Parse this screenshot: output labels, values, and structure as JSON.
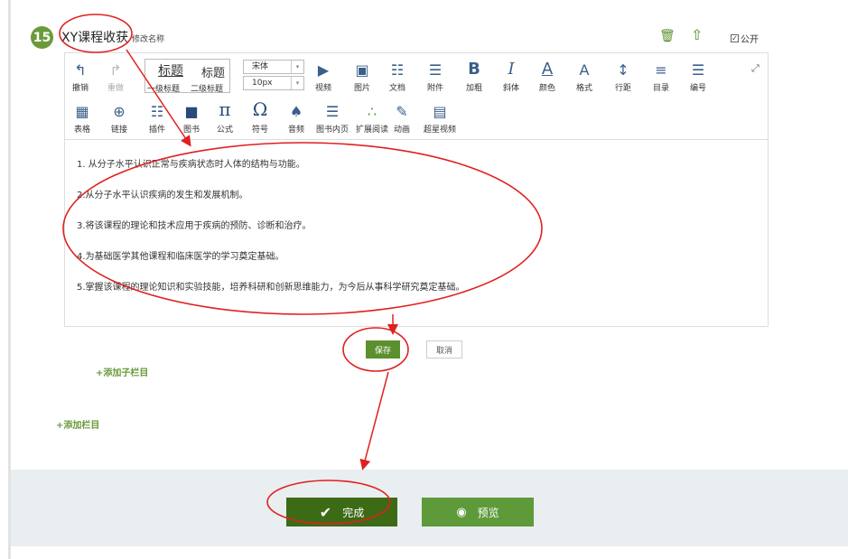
{
  "section": {
    "number": "15",
    "title": "XY课程收获",
    "rename_label": "修改名称",
    "public_label": "公开"
  },
  "toolbar": {
    "undo": "撤销",
    "redo": "重做",
    "heading1_big": "标题",
    "heading2_big": "标题",
    "heading1_small": "一级标题",
    "heading2_small": "二级标题",
    "font_value": "宋体",
    "size_value": "10px",
    "video": "视频",
    "image": "图片",
    "document": "文档",
    "attachment": "附件",
    "bold": "加粗",
    "italic": "斜体",
    "color": "颜色",
    "format": "格式",
    "line_spacing": "行距",
    "toc": "目录",
    "numbering": "编号",
    "table": "表格",
    "link": "链接",
    "plugin": "插件",
    "book": "图书",
    "formula": "公式",
    "symbol": "符号",
    "audio": "音频",
    "book_inner_page": "图书内页",
    "extended_reading": "扩展阅读",
    "animation": "动画",
    "super_video": "超星视频"
  },
  "content": {
    "items": [
      "1. 从分子水平认识正常与疾病状态时人体的结构与功能。",
      "2.从分子水平认识疾病的发生和发展机制。",
      "3.将该课程的理论和技术应用于疾病的预防、诊断和治疗。",
      "4.为基础医学其他课程和临床医学的学习奠定基础。",
      "5.掌握该课程的理论知识和实验技能，培养科研和创新思维能力，为今后从事科学研究奠定基础。"
    ]
  },
  "actions": {
    "save": "保存",
    "cancel": "取消",
    "add_subcolumn": "+添加子栏目",
    "add_column": "+添加栏目"
  },
  "footer": {
    "done": "完成",
    "preview": "预览"
  }
}
